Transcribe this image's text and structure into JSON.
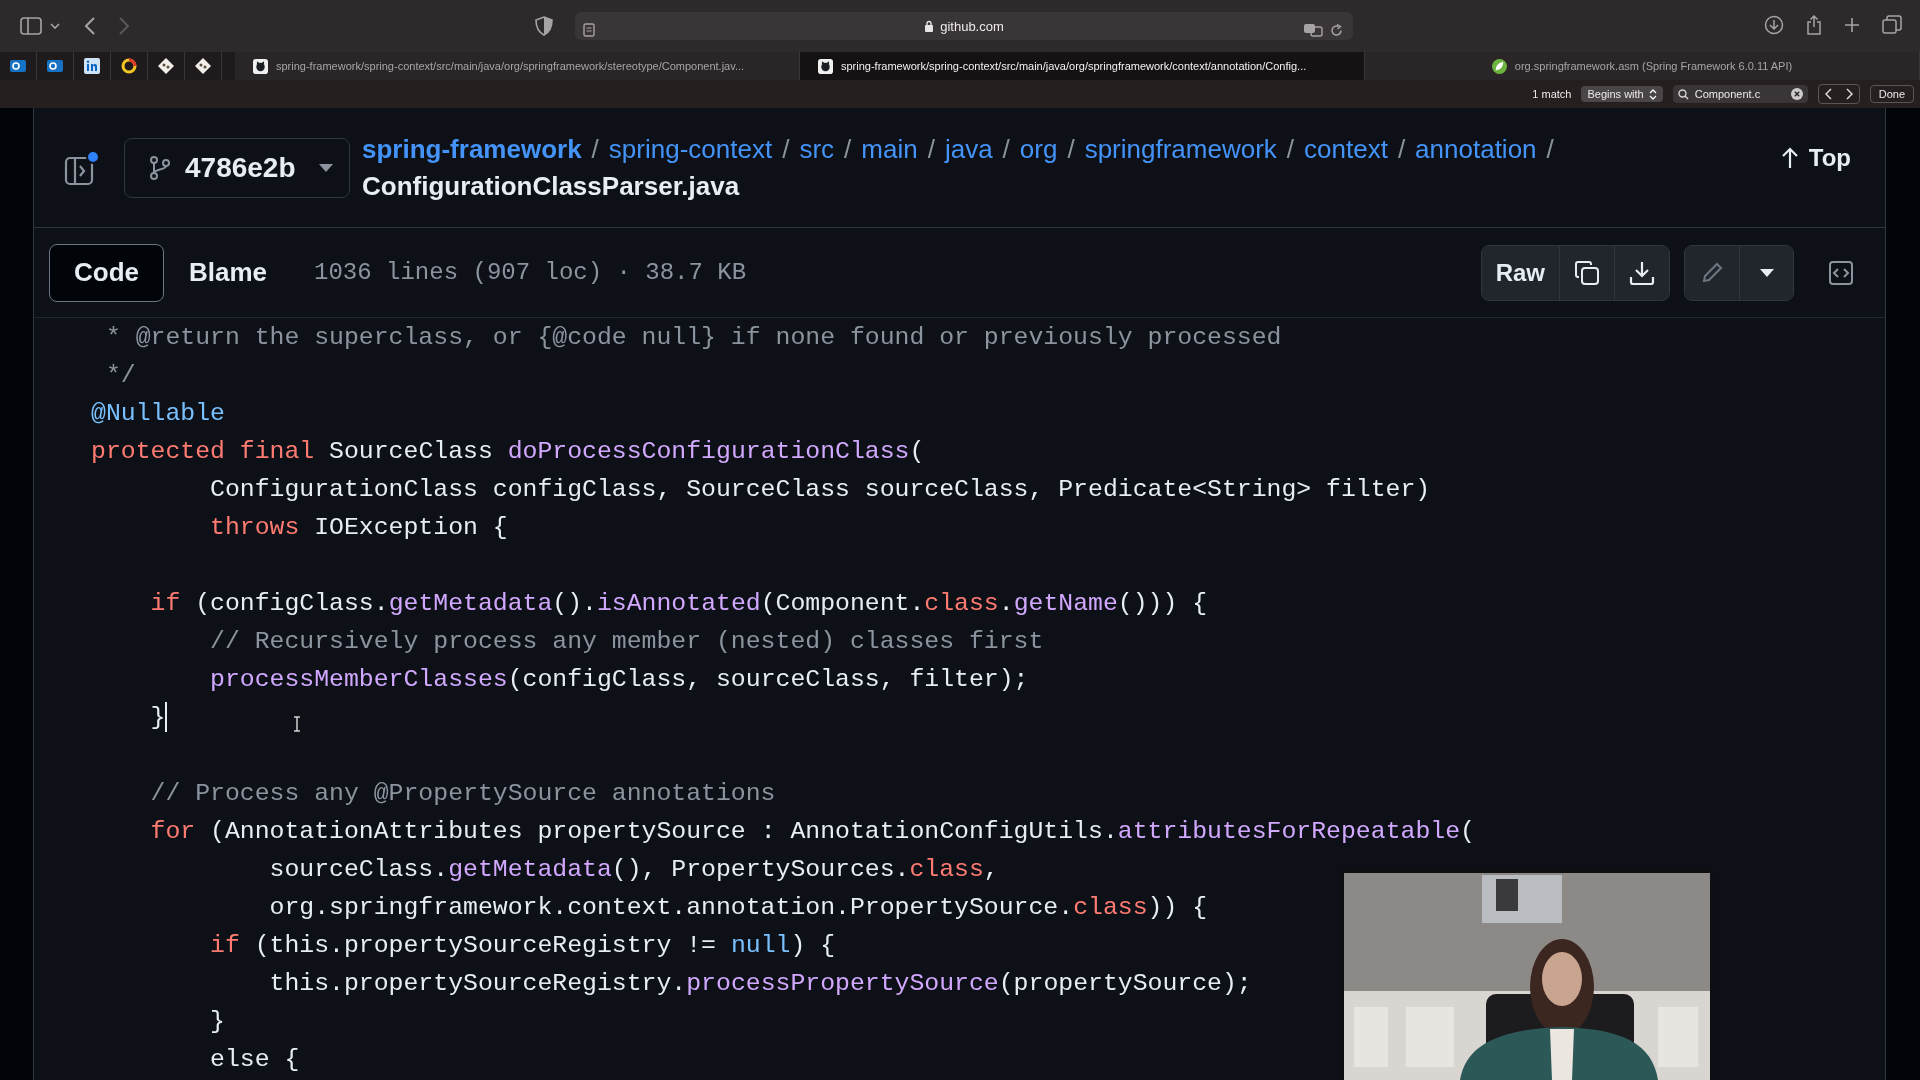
{
  "browser": {
    "address": "github.com",
    "tabs": [
      {
        "title": "spring-framework/spring-context/src/main/java/org/springframework/stereotype/Component.jav...",
        "selected": false
      },
      {
        "title": "spring-framework/spring-context/src/main/java/org/springframework/context/annotation/Config...",
        "selected": true
      },
      {
        "title": "org.springframework.asm (Spring Framework 6.0.11 API)",
        "selected": false
      }
    ],
    "find_bar": {
      "match_count": "1 match",
      "mode": "Begins with",
      "value": "Component.c",
      "done": "Done"
    }
  },
  "repo": {
    "branch": "4786e2b",
    "breadcrumb": [
      {
        "label": "spring-framework"
      },
      {
        "separator": "/",
        "label": "spring-context"
      },
      {
        "separator": "/",
        "label": "src"
      },
      {
        "separator": "/",
        "label": "main"
      },
      {
        "separator": "/",
        "label": "java"
      },
      {
        "separator": "/",
        "label": "org"
      },
      {
        "separator": "/",
        "label": "springframework"
      },
      {
        "separator": "/",
        "label": "context"
      },
      {
        "separator": "/",
        "label": "annotation"
      }
    ],
    "file": {
      "separator": "/",
      "label": "ConfigurationClassParser.java"
    },
    "top": "Top"
  },
  "file_toolbar": {
    "views": [
      {
        "label": "Code",
        "selected": true
      },
      {
        "label": "Blame",
        "selected": false
      }
    ],
    "info": "1036 lines (907 loc) · 38.7 KB",
    "raw": "Raw"
  },
  "code": {
    "lines": [
      {
        "kind": "code",
        "caret": false,
        "segments": [
          {
            "text": " * @return the superclass, or {@code null} if none found or previously processed",
            "kind": "comment"
          }
        ]
      },
      {
        "kind": "code",
        "caret": false,
        "segments": [
          {
            "text": " */",
            "kind": "comment"
          }
        ]
      },
      {
        "kind": "code",
        "caret": false,
        "segments": [
          {
            "text": "@Nullable",
            "kind": "constant"
          }
        ]
      },
      {
        "kind": "code",
        "caret": false,
        "segments": [
          {
            "text": "protected ",
            "kind": "keyword"
          },
          {
            "text": "final",
            "kind": "keyword"
          },
          {
            "text": " SourceClass ",
            "kind": "plain"
          },
          {
            "text": "doProcessConfigurationClass",
            "kind": "function"
          },
          {
            "text": "(",
            "kind": "plain"
          }
        ]
      },
      {
        "kind": "code",
        "caret": false,
        "segments": [
          {
            "text": "        ConfigurationClass configClass, SourceClass sourceClass, Predicate<String> filter)",
            "kind": "plain"
          }
        ]
      },
      {
        "kind": "code",
        "caret": false,
        "segments": [
          {
            "text": "        throws",
            "kind": "keyword"
          },
          {
            "text": " IOException {",
            "kind": "plain"
          }
        ]
      },
      {
        "kind": "blank"
      },
      {
        "kind": "code",
        "caret": false,
        "segments": [
          {
            "text": "    if",
            "kind": "keyword"
          },
          {
            "text": " (configClass.",
            "kind": "plain"
          },
          {
            "text": "getMetadata",
            "kind": "function"
          },
          {
            "text": "().",
            "kind": "plain"
          },
          {
            "text": "isAnnotated",
            "kind": "function"
          },
          {
            "text": "(Component.",
            "kind": "plain"
          },
          {
            "text": "class",
            "kind": "keyword"
          },
          {
            "text": ".",
            "kind": "plain"
          },
          {
            "text": "getName",
            "kind": "function"
          },
          {
            "text": "())) {",
            "kind": "plain"
          }
        ]
      },
      {
        "kind": "code",
        "caret": false,
        "segments": [
          {
            "text": "        // Recursively process any member (nested) classes first",
            "kind": "comment"
          }
        ]
      },
      {
        "kind": "code",
        "caret": false,
        "segments": [
          {
            "text": "        processMemberClasses",
            "kind": "function"
          },
          {
            "text": "(configClass, sourceClass, filter);",
            "kind": "plain"
          }
        ]
      },
      {
        "kind": "code",
        "caret": true,
        "segments": [
          {
            "text": "    }",
            "kind": "plain"
          }
        ]
      },
      {
        "kind": "blank"
      },
      {
        "kind": "code",
        "caret": false,
        "segments": [
          {
            "text": "    // Process any @PropertySource annotations",
            "kind": "comment"
          }
        ]
      },
      {
        "kind": "code",
        "caret": false,
        "segments": [
          {
            "text": "    for",
            "kind": "keyword"
          },
          {
            "text": " (AnnotationAttributes propertySource : AnnotationConfigUtils.",
            "kind": "plain"
          },
          {
            "text": "attributesForRepeatable",
            "kind": "function"
          },
          {
            "text": "(",
            "kind": "plain"
          }
        ]
      },
      {
        "kind": "code",
        "caret": false,
        "segments": [
          {
            "text": "            sourceClass.",
            "kind": "plain"
          },
          {
            "text": "getMetadata",
            "kind": "function"
          },
          {
            "text": "(), PropertySources.",
            "kind": "plain"
          },
          {
            "text": "class",
            "kind": "keyword"
          },
          {
            "text": ",",
            "kind": "plain"
          }
        ]
      },
      {
        "kind": "code",
        "caret": false,
        "segments": [
          {
            "text": "            org.springframework.context.annotation.PropertySource.",
            "kind": "plain"
          },
          {
            "text": "class",
            "kind": "keyword"
          },
          {
            "text": ")) {",
            "kind": "plain"
          }
        ]
      },
      {
        "kind": "code",
        "caret": false,
        "segments": [
          {
            "text": "        if",
            "kind": "keyword"
          },
          {
            "text": " (this.propertySourceRegistry != ",
            "kind": "plain"
          },
          {
            "text": "null",
            "kind": "constant"
          },
          {
            "text": ") {",
            "kind": "plain"
          }
        ]
      },
      {
        "kind": "code",
        "caret": false,
        "segments": [
          {
            "text": "            this.propertySourceRegistry.",
            "kind": "plain"
          },
          {
            "text": "processPropertySource",
            "kind": "function"
          },
          {
            "text": "(propertySource);",
            "kind": "plain"
          }
        ]
      },
      {
        "kind": "code",
        "caret": false,
        "segments": [
          {
            "text": "        }",
            "kind": "plain"
          }
        ]
      },
      {
        "kind": "code",
        "caret": false,
        "segments": [
          {
            "text": "        else {",
            "kind": "plain"
          }
        ]
      }
    ]
  }
}
